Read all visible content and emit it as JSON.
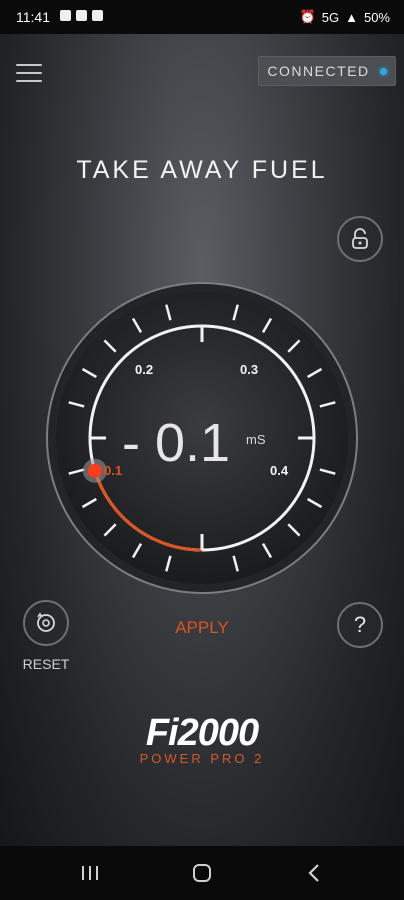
{
  "status_bar": {
    "time": "11:41",
    "network": "5G",
    "battery": "50%"
  },
  "header": {
    "connection_status": "CONNECTED",
    "status_color": "#2ea8e6"
  },
  "title": "TAKE AWAY FUEL",
  "gauge": {
    "value_text": "- 0.1",
    "unit": "mS",
    "value": -0.1,
    "tick_labels": [
      "0.1",
      "0.2",
      "0.3",
      "0.4"
    ],
    "accent_color": "#e0531e"
  },
  "controls": {
    "apply_label": "APPLY",
    "reset_label": "RESET",
    "help_label": "?"
  },
  "brand": {
    "logo": "Fi2000",
    "subtitle": "POWER PRO 2"
  },
  "icons": [
    "menu-icon",
    "lock-icon",
    "reset-icon",
    "help-icon",
    "back-icon",
    "home-icon",
    "recents-icon"
  ]
}
